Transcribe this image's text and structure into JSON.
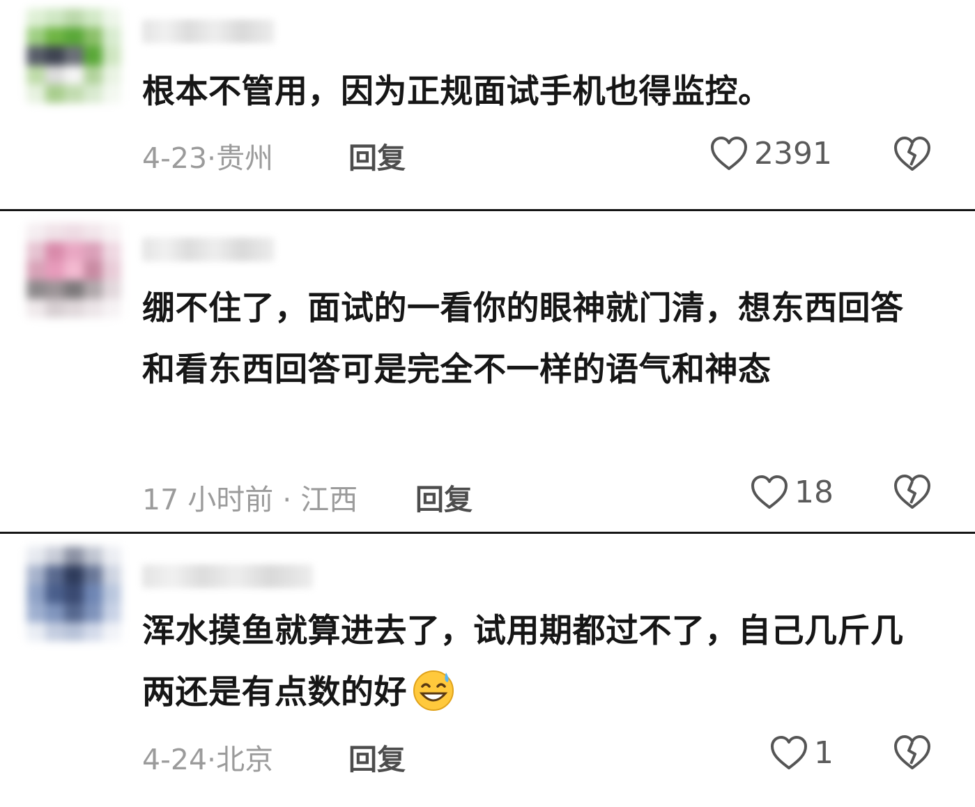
{
  "comments": [
    {
      "text": "根本不管用，因为正规面试手机也得监控。",
      "meta": "4-23·贵州",
      "reply_label": "回复",
      "likes": "2391",
      "avatar_colors": [
        "#dff0d6",
        "#cfe7c4",
        "#bcd9ac",
        "#d2e9c7",
        "#eef6ea",
        "#9fcf83",
        "#6fb544",
        "#5aa838",
        "#8cc06a",
        "#d8ecd0",
        "#595e6a",
        "#3f4452",
        "#6b6f78",
        "#5aa838",
        "#cfe6c1",
        "#bfdca9",
        "#dcdcdc",
        "#f4f4f4",
        "#b2d39c",
        "#e9f3e3",
        "#e6f1df",
        "#a9ce8e",
        "#c2dcb0",
        "#d9ead0",
        "#f3f8f0"
      ]
    },
    {
      "text": "绷不住了，面试的一看你的眼神就门清，想东西回答和看东西回答可是完全不一样的语气和神态",
      "meta": "17 小时前 · 江西",
      "reply_label": "回复",
      "likes": "18",
      "avatar_colors": [
        "#f5eef1",
        "#f0e2e8",
        "#eedce4",
        "#f2e6eb",
        "#f8f3f5",
        "#e6c4d2",
        "#d98bab",
        "#e9a7c3",
        "#dba0b9",
        "#efd8e2",
        "#d8a3b8",
        "#e79bbb",
        "#f3b9d0",
        "#c98ba3",
        "#e9ccd8",
        "#8e8a8c",
        "#9c9497",
        "#7e7a7c",
        "#b0a8ab",
        "#e2d8dc",
        "#efe9eb",
        "#d7cfd2",
        "#e0d8db",
        "#ece5e8",
        "#f6f2f4"
      ]
    },
    {
      "text": "浑水摸鱼就算进去了，试用期都过不了，自己几斤几两还是有点数的好",
      "meta": "4-24·北京",
      "reply_label": "回复",
      "likes": "1",
      "avatar_colors": [
        "#e7eaf0",
        "#c9cdd8",
        "#8d93a5",
        "#c1c6d2",
        "#eceef3",
        "#a7b3cc",
        "#5a6a8f",
        "#2f3c5c",
        "#6a7898",
        "#cfd5e2",
        "#8fa2c6",
        "#4a5f8c",
        "#3a4a72",
        "#6f86b4",
        "#bac7de",
        "#9fb0d0",
        "#8095bd",
        "#56688f",
        "#7f93bb",
        "#c8d2e6",
        "#e9edf4",
        "#c4cde0",
        "#b7c2d8",
        "#d3daea",
        "#f1f3f8"
      ]
    }
  ],
  "colors": {
    "divider": "#151515",
    "text": "#161616",
    "meta": "#9b9b9b",
    "reply": "#4d4d4d",
    "icon": "#555555"
  }
}
